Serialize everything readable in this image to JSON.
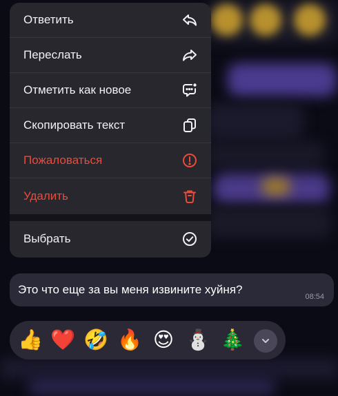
{
  "menu": {
    "items": [
      {
        "label": "Ответить",
        "icon": "reply-icon",
        "style": "normal"
      },
      {
        "label": "Переслать",
        "icon": "forward-icon",
        "style": "normal"
      },
      {
        "label": "Отметить как новое",
        "icon": "mark-unread-icon",
        "style": "normal"
      },
      {
        "label": "Скопировать текст",
        "icon": "copy-icon",
        "style": "normal"
      },
      {
        "label": "Пожаловаться",
        "icon": "report-icon",
        "style": "danger"
      },
      {
        "label": "Удалить",
        "icon": "trash-icon",
        "style": "danger"
      },
      {
        "label": "Выбрать",
        "icon": "select-check-icon",
        "style": "normal"
      }
    ]
  },
  "message": {
    "text": "Это что еще за вы меня извините хуйня?",
    "time": "08:54"
  },
  "reactions": {
    "items": [
      {
        "emoji": "👍",
        "name": "thumbs-up"
      },
      {
        "emoji": "❤️",
        "name": "red-heart"
      },
      {
        "emoji": "🤣",
        "name": "rolling-laughing"
      },
      {
        "emoji": "🔥",
        "name": "fire"
      },
      {
        "emoji": "😍",
        "name": "heart-eyes"
      },
      {
        "emoji": "⛄",
        "name": "snowman"
      },
      {
        "emoji": "🎄",
        "name": "christmas-tree"
      }
    ],
    "expand_icon": "chevron-down-icon"
  },
  "colors": {
    "danger": "#ec4b3a",
    "menu_bg": "#28282e",
    "bubble_bg": "#2a2a38",
    "text": "#f2f2f4"
  }
}
